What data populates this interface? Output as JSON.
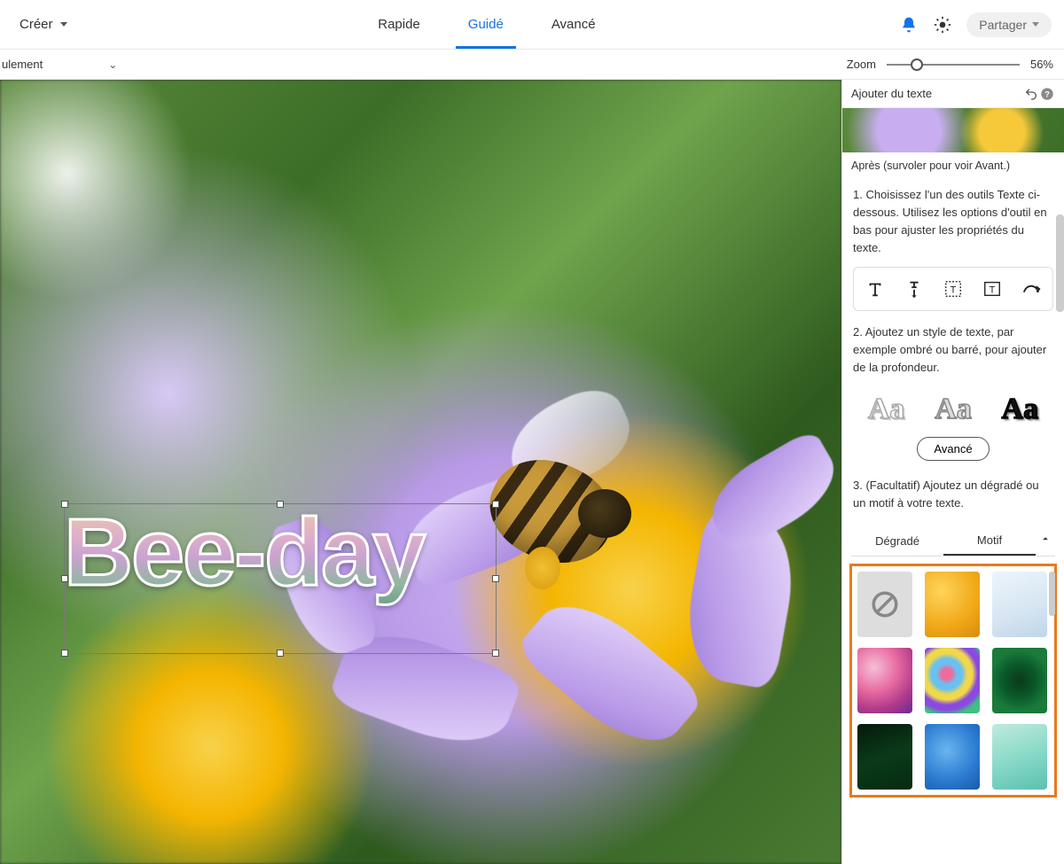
{
  "topbar": {
    "create": "Créer",
    "tabs": {
      "rapide": "Rapide",
      "guide": "Guidé",
      "avance": "Avancé"
    },
    "share": "Partager"
  },
  "subbar": {
    "left_dropdown": "ulement",
    "zoom_label": "Zoom",
    "zoom_value": "56%",
    "zoom_position_pct": 18
  },
  "canvas": {
    "overlay_text": "Bee-day"
  },
  "panel": {
    "title": "Ajouter du texte",
    "preview_caption": "Après (survoler pour voir Avant.)",
    "step1": "1. Choisissez l'un des outils Texte ci-dessous. Utilisez les options d'outil en bas pour ajuster les propriétés du texte.",
    "step2": "2. Ajoutez un style de texte, par exemple ombré ou barré, pour ajouter de la profondeur.",
    "style_sample": "Aa",
    "advanced_btn": "Avancé",
    "step3": "3. (Facultatif) Ajoutez un dégradé ou un motif à votre texte.",
    "tab_gradient": "Dégradé",
    "tab_pattern": "Motif"
  }
}
